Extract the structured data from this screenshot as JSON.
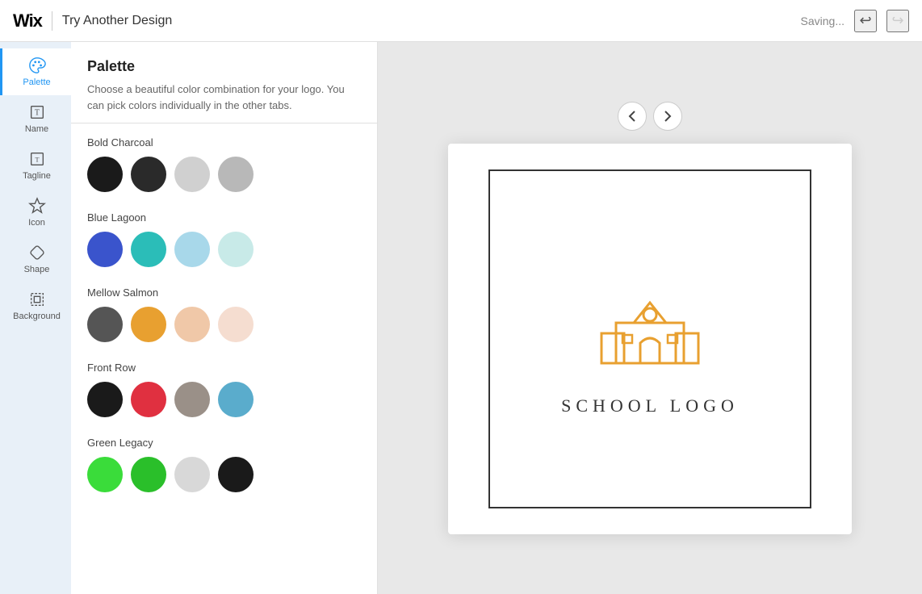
{
  "topbar": {
    "logo": "Wix",
    "divider": true,
    "title": "Try Another Design",
    "saving_label": "Saving...",
    "undo_icon": "↩",
    "redo_icon": "↪"
  },
  "sidebar": {
    "items": [
      {
        "id": "palette",
        "label": "Palette",
        "active": true
      },
      {
        "id": "name",
        "label": "Name",
        "active": false
      },
      {
        "id": "tagline",
        "label": "Tagline",
        "active": false
      },
      {
        "id": "icon",
        "label": "Icon",
        "active": false
      },
      {
        "id": "shape",
        "label": "Shape",
        "active": false
      },
      {
        "id": "background",
        "label": "Background",
        "active": false
      }
    ]
  },
  "palette_panel": {
    "title": "Palette",
    "description": "Choose a beautiful color combination for your logo. You can pick colors individually in the other tabs.",
    "groups": [
      {
        "name": "Bold Charcoal",
        "swatches": [
          "#1a1a1a",
          "#2a2a2a",
          "#d0d0d0",
          "#b8b8b8"
        ]
      },
      {
        "name": "Blue Lagoon",
        "swatches": [
          "#3a54cc",
          "#2bbdb8",
          "#a8d8ea",
          "#c8eae8"
        ]
      },
      {
        "name": "Mellow Salmon",
        "swatches": [
          "#555555",
          "#e8a030",
          "#f0c8a8",
          "#f5ddd0"
        ]
      },
      {
        "name": "Front Row",
        "swatches": [
          "#1a1a1a",
          "#e03040",
          "#9a9088",
          "#5aaccc"
        ]
      },
      {
        "name": "Green Legacy",
        "swatches": [
          "#3adc3a",
          "#2abf2a",
          "#d8d8d8",
          "#1a1a1a"
        ]
      }
    ]
  },
  "canvas": {
    "prev_icon": "‹",
    "next_icon": "›",
    "logo_text": "School Logo",
    "logo_color": "#e8a030"
  }
}
